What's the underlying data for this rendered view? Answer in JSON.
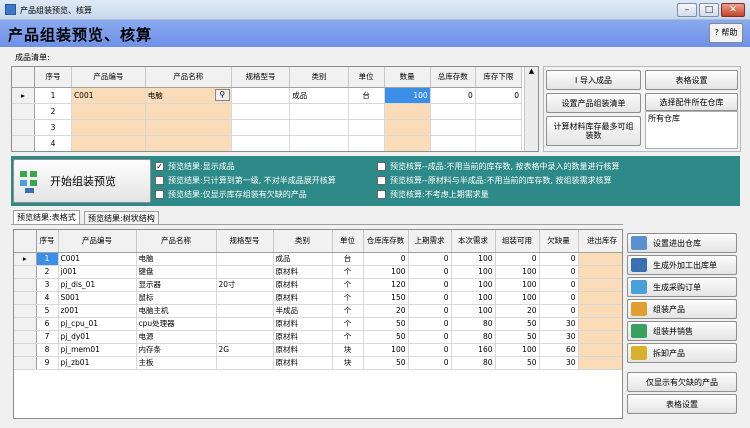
{
  "window": {
    "title": "产品组装预览、核算",
    "min": "–",
    "max": "□",
    "close": "✕"
  },
  "header": {
    "title": "产品组装预览、核算",
    "help": "? 帮助"
  },
  "bom": {
    "label": "成品清单:",
    "columns": [
      "序号",
      "产品编号",
      "产品名称",
      "规格型号",
      "类别",
      "单位",
      "数量",
      "总库存数",
      "库存下限"
    ],
    "rows": [
      {
        "no": "1",
        "code": "C001",
        "name": "电脑",
        "spec": "",
        "cat": "成品",
        "unit": "台",
        "qty": "100",
        "stock": "0",
        "min": "0"
      },
      {
        "no": "2",
        "code": "",
        "name": "",
        "spec": "",
        "cat": "",
        "unit": "",
        "qty": "",
        "stock": "",
        "min": ""
      },
      {
        "no": "3",
        "code": "",
        "name": "",
        "spec": "",
        "cat": "",
        "unit": "",
        "qty": "",
        "stock": "",
        "min": ""
      },
      {
        "no": "4",
        "code": "",
        "name": "",
        "spec": "",
        "cat": "",
        "unit": "",
        "qty": "",
        "stock": "",
        "min": ""
      }
    ]
  },
  "actions": {
    "import": "I 导入成品",
    "table_settings": "表格设置",
    "set_bom": "设置产品组装清单",
    "choose_warehouse": "选择配件所在仓库",
    "calc_max": "计算材料库存最多可组装数",
    "warehouse_value": "所有仓库"
  },
  "band": {
    "start": "开始组装预览",
    "options": [
      {
        "checked": true,
        "text": "预览结果:显示成品"
      },
      {
        "checked": false,
        "text": "预览结果:只计算到第一级, 不对半成品展开核算"
      },
      {
        "checked": false,
        "text": "预览结果:仅显示库存组装有欠缺的产品"
      },
      {
        "checked": false,
        "text": "预览核算--成品:不用当前的库存数, 按表格中录入的数量进行核算"
      },
      {
        "checked": false,
        "text": "预览核算--原材料与半成品:不用当前的库存数, 按组装需求核算"
      },
      {
        "checked": false,
        "text": "预览核算:不考虑上期需求量"
      }
    ]
  },
  "tabs": [
    "预览结果:表格式",
    "预览结果:树状结构"
  ],
  "result": {
    "columns": [
      "序号",
      "产品编号",
      "产品名称",
      "规格型号",
      "类别",
      "单位",
      "仓库库存数",
      "上期需求",
      "本次需求",
      "组装可用",
      "欠缺量",
      "进出库存"
    ],
    "rows": [
      {
        "no": "1",
        "code": "C001",
        "name": "电脑",
        "spec": "",
        "cat": "成品",
        "unit": "台",
        "stock": "0",
        "prev": "0",
        "need": "100",
        "avail": "0",
        "short": "0"
      },
      {
        "no": "2",
        "code": "j001",
        "name": "键盘",
        "spec": "",
        "cat": "原材料",
        "unit": "个",
        "stock": "100",
        "prev": "0",
        "need": "100",
        "avail": "100",
        "short": "0"
      },
      {
        "no": "3",
        "code": "pj_dis_01",
        "name": "显示器",
        "spec": "20寸",
        "cat": "原材料",
        "unit": "个",
        "stock": "120",
        "prev": "0",
        "need": "100",
        "avail": "100",
        "short": "0"
      },
      {
        "no": "4",
        "code": "S001",
        "name": "鼠标",
        "spec": "",
        "cat": "原材料",
        "unit": "个",
        "stock": "150",
        "prev": "0",
        "need": "100",
        "avail": "100",
        "short": "0"
      },
      {
        "no": "5",
        "code": "z001",
        "name": "电脑主机",
        "spec": "",
        "cat": "半成品",
        "unit": "个",
        "stock": "20",
        "prev": "0",
        "need": "100",
        "avail": "20",
        "short": "0"
      },
      {
        "no": "6",
        "code": "pj_cpu_01",
        "name": "cpu处理器",
        "spec": "",
        "cat": "原材料",
        "unit": "个",
        "stock": "50",
        "prev": "0",
        "need": "80",
        "avail": "50",
        "short": "30"
      },
      {
        "no": "7",
        "code": "pj_dy01",
        "name": "电源",
        "spec": "",
        "cat": "原材料",
        "unit": "个",
        "stock": "50",
        "prev": "0",
        "need": "80",
        "avail": "50",
        "short": "30"
      },
      {
        "no": "8",
        "code": "pj_mem01",
        "name": "内存条",
        "spec": "2G",
        "cat": "原材料",
        "unit": "块",
        "stock": "100",
        "prev": "0",
        "need": "160",
        "avail": "100",
        "short": "60"
      },
      {
        "no": "9",
        "code": "pj_zb01",
        "name": "主板",
        "spec": "",
        "cat": "原材料",
        "unit": "块",
        "stock": "50",
        "prev": "0",
        "need": "80",
        "avail": "50",
        "short": "30"
      }
    ]
  },
  "side_buttons": [
    {
      "label": "设置进出仓库",
      "icon": "warehouse-icon",
      "color": "#5a8fd0"
    },
    {
      "label": "生成外加工出库单",
      "icon": "outsource-icon",
      "color": "#3a6fb0"
    },
    {
      "label": "生成采购订单",
      "icon": "purchase-icon",
      "color": "#4aa0d8"
    },
    {
      "label": "组装产品",
      "icon": "assemble-icon",
      "color": "#e0a030"
    },
    {
      "label": "组装并销售",
      "icon": "assemble-sell-icon",
      "color": "#3aa060"
    },
    {
      "label": "拆卸产品",
      "icon": "disassemble-icon",
      "color": "#d8b030"
    }
  ],
  "bottom_buttons": {
    "show_short": "仅显示有欠缺的产品",
    "table_settings": "表格设置"
  }
}
